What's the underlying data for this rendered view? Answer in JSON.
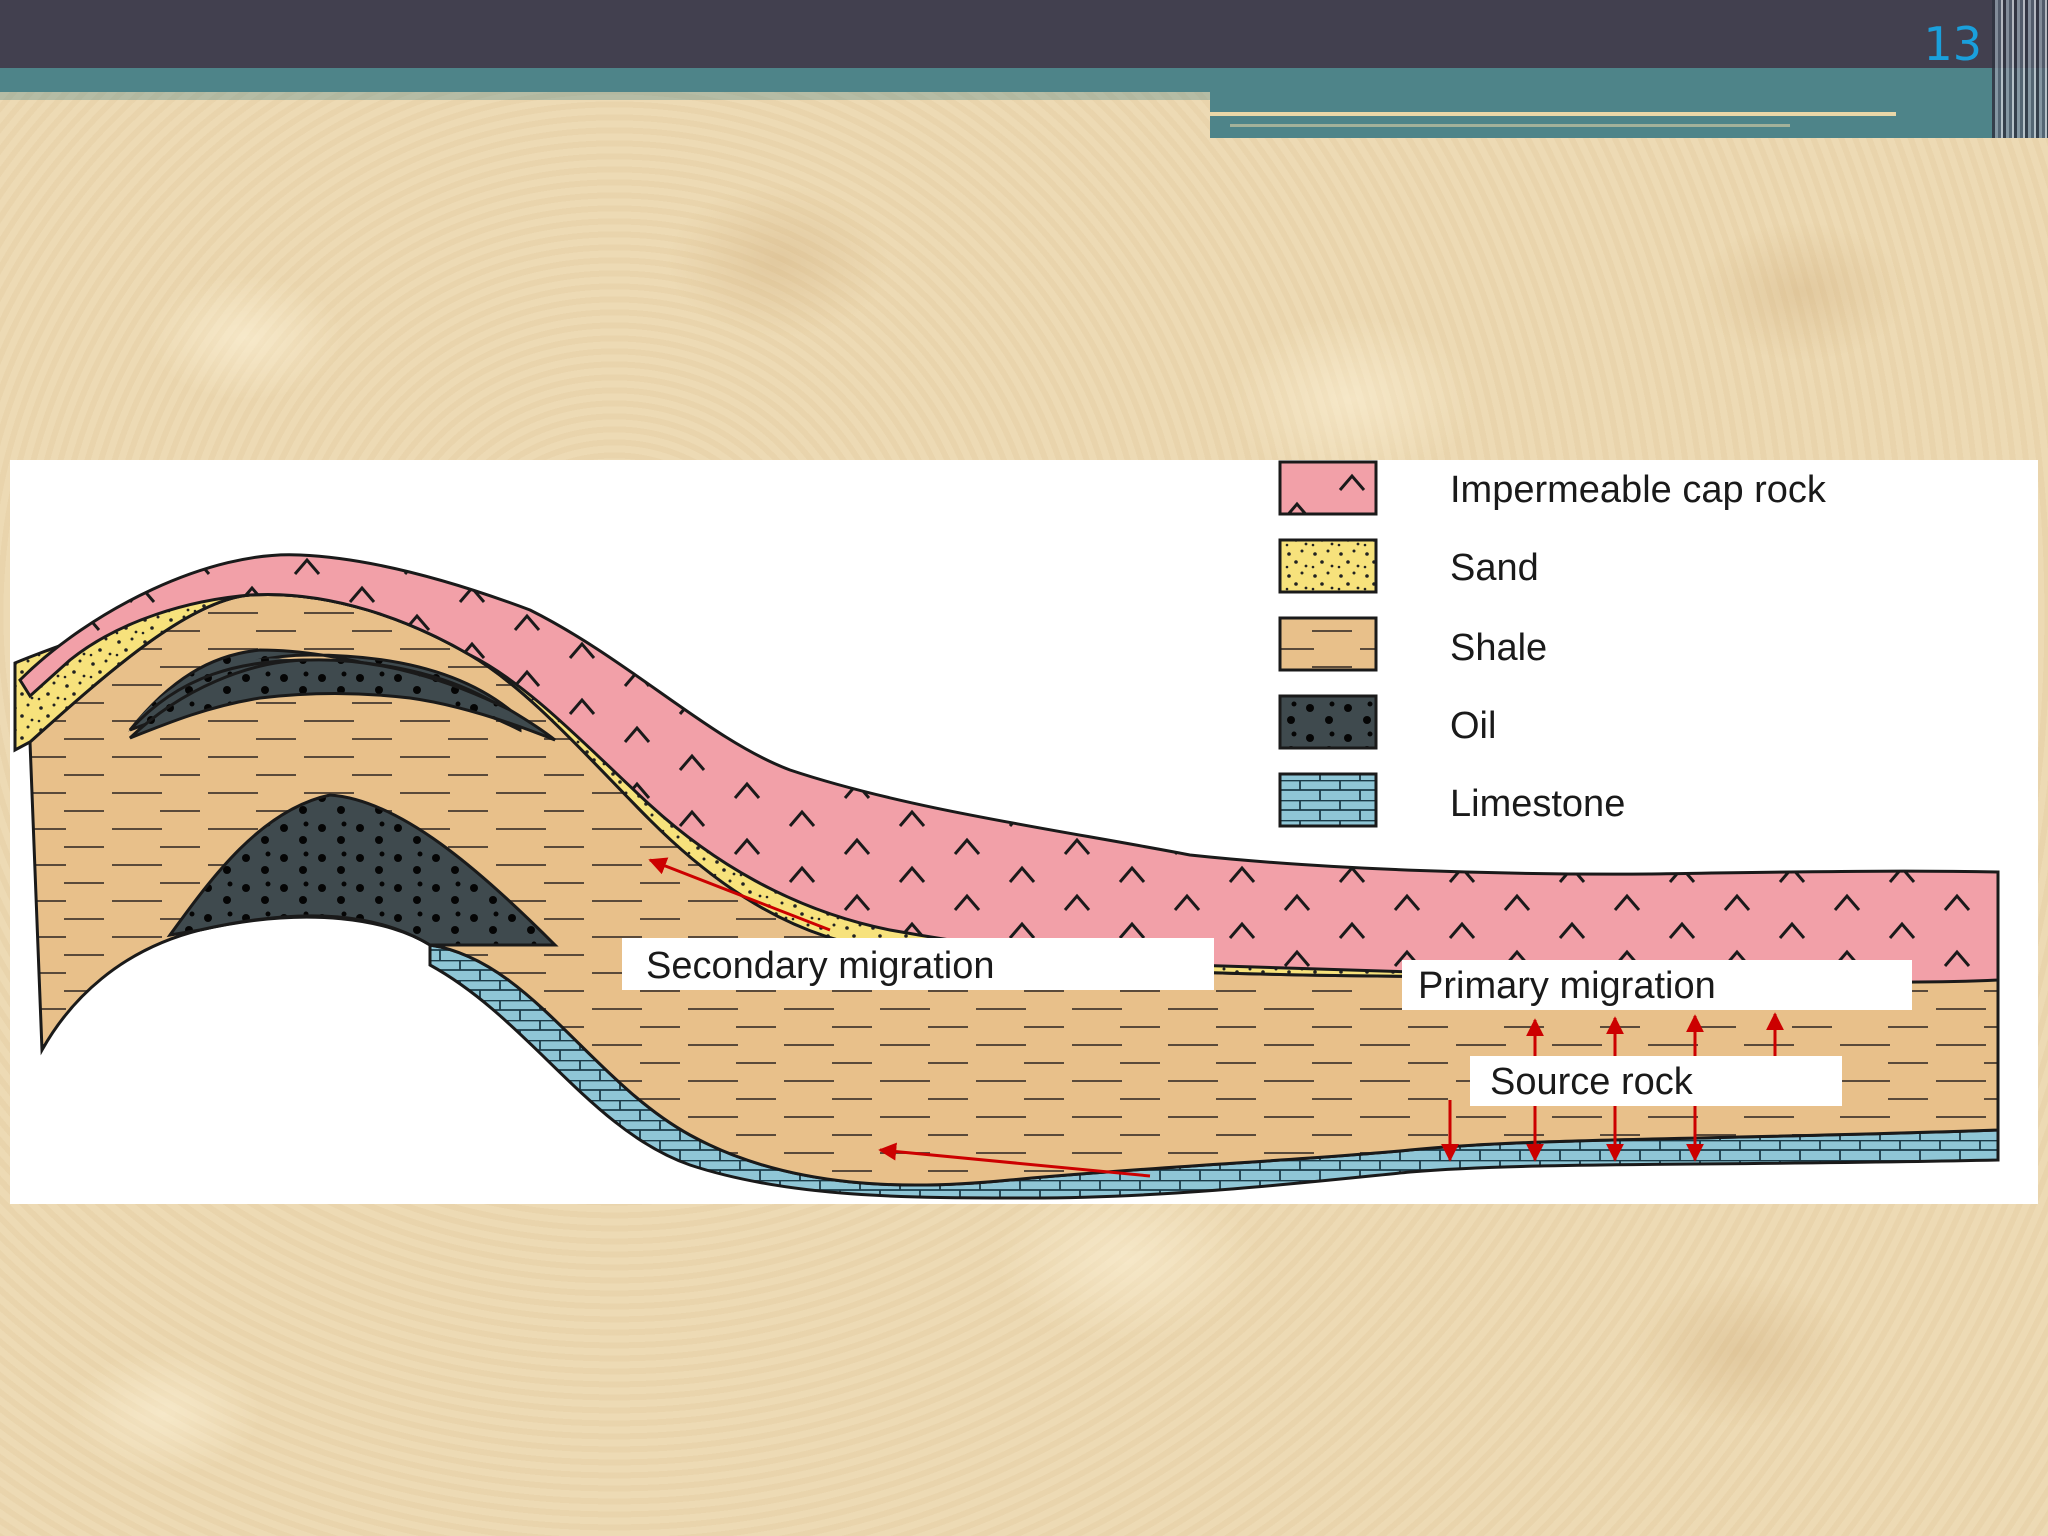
{
  "slide": {
    "number": "13"
  },
  "legend": [
    {
      "key": "cap",
      "label": "Impermeable cap rock",
      "color": "#f2a0a8"
    },
    {
      "key": "sand",
      "label": "Sand",
      "color": "#f7e27c"
    },
    {
      "key": "shale",
      "label": "Shale",
      "color": "#e8c08a"
    },
    {
      "key": "oil",
      "label": "Oil",
      "color": "#3f4a4e"
    },
    {
      "key": "limestone",
      "label": "Limestone",
      "color": "#8fc6d6"
    }
  ],
  "labels": {
    "secondary": "Secondary migration",
    "primary": "Primary migration",
    "source": "Source rock"
  },
  "colors": {
    "arrow": "#cc0000",
    "accent": "#1aa0dc"
  }
}
